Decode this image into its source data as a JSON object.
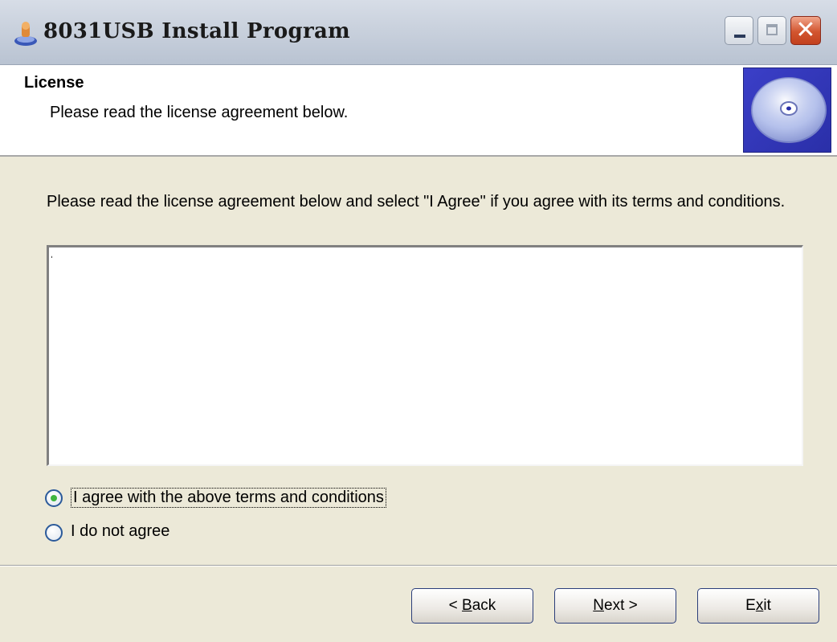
{
  "window": {
    "title": "8031USB Install Program",
    "close_glyph": "✕"
  },
  "header": {
    "title": "License",
    "subtitle": "Please read the license agreement below."
  },
  "content": {
    "intro": "Please read the license agreement below and select \"I Agree\" if you agree with its terms and conditions.",
    "license_text": "ˈ"
  },
  "options": {
    "agree_label": "I agree with the above terms and conditions",
    "disagree_label": "I do not agree",
    "selected": "agree"
  },
  "buttons": {
    "back_prefix": "< ",
    "back_mnemonic": "B",
    "back_rest": "ack",
    "next_mnemonic": "N",
    "next_rest": "ext >",
    "exit_prefix": "E",
    "exit_mnemonic": "x",
    "exit_rest": "it"
  },
  "icons": {
    "app": "installer-icon",
    "header": "cd-disc-icon"
  }
}
